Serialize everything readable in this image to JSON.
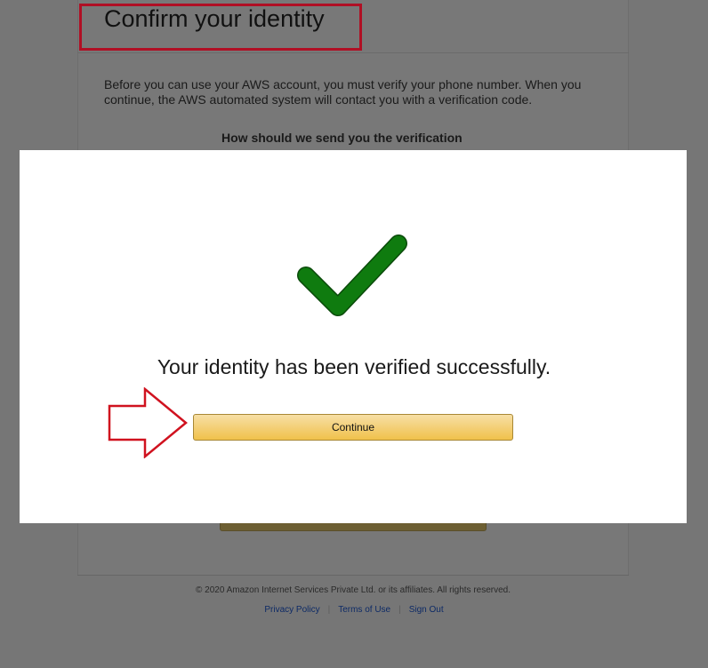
{
  "page": {
    "title": "Confirm your identity",
    "intro": "Before you can use your AWS account, you must verify your phone number. When you continue, the AWS automated system will contact you with a verification code.",
    "method_question": "How should we send you the verification"
  },
  "modal": {
    "icon": "check-icon",
    "icon_color": "#0f7b0f",
    "message": "Your identity has been verified successfully.",
    "continue_label": "Continue"
  },
  "annotations": {
    "highlight_color": "#c8102e",
    "arrow_icon": "arrow-right-outline-icon"
  },
  "footer": {
    "copyright": "© 2020 Amazon Internet Services Private Ltd. or its affiliates. All rights reserved.",
    "links": [
      "Privacy Policy",
      "Terms of Use",
      "Sign Out"
    ]
  }
}
